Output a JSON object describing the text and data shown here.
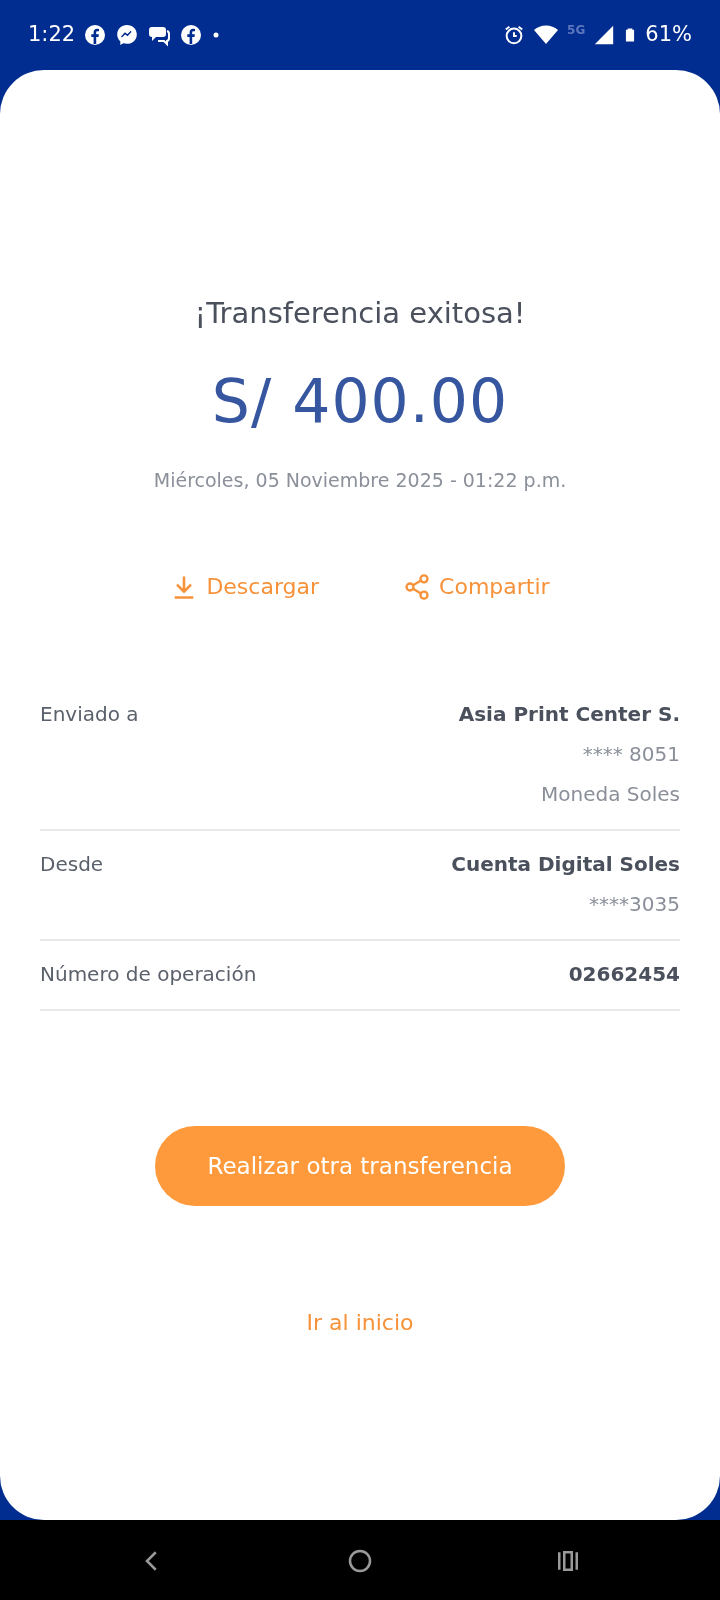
{
  "status_bar": {
    "time": "1:22",
    "network": "5G",
    "battery": "61%"
  },
  "title": "¡Transferencia exitosa!",
  "amount": "S/ 400.00",
  "date": "Miércoles, 05 Noviembre 2025 - 01:22 p.m.",
  "actions": [
    {
      "kind": "download",
      "label": "Descargar"
    },
    {
      "kind": "share",
      "label": "Compartir"
    }
  ],
  "details": [
    {
      "label": "Enviado a",
      "values": [
        "Asia Print Center S.",
        "**** 8051",
        "Moneda Soles"
      ]
    },
    {
      "label": "Desde",
      "values": [
        "Cuenta Digital Soles",
        "****3035"
      ]
    },
    {
      "label": "Número de operación",
      "values": [
        "02662454"
      ]
    }
  ],
  "primary_button": "Realizar otra transferencia",
  "link": "Ir al inicio"
}
